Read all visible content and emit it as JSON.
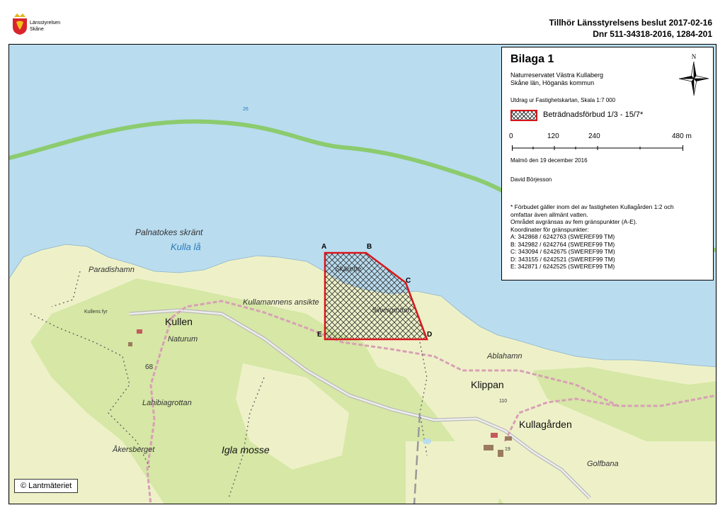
{
  "header": {
    "org_line1": "Länsstyrelsen",
    "org_line2": "Skåne",
    "decision": "Tillhör Länsstyrelsens beslut 2017-02-16",
    "dnr": "Dnr 511-34318-2016, 1284-201"
  },
  "legend": {
    "title": "Bilaga 1",
    "reserve": "Naturreservatet Västra Kullaberg",
    "county": "Skåne län, Höganäs kommun",
    "extract": "Utdrag ur Fastighetskartan, Skala 1:7 000",
    "swatch_label": "Beträdnadsförbud 1/3 - 15/7*",
    "scale": [
      "0",
      "120",
      "240",
      "480 m"
    ],
    "date": "Malmö den 19 december 2016",
    "author": "David Börjesson",
    "note": [
      "* Förbudet gäller inom del av fastigheten Kullagården 1:2 och",
      "omfattar även allmänt vatten.",
      "Området avgränsas av fem gränspunkter (A-E).",
      "Koordinater för gränspunkter:",
      "A: 342868 / 6242763 (SWEREF99 TM)",
      "B: 342982 / 6242764 (SWEREF99 TM)",
      "C: 343094 / 6242675 (SWEREF99 TM)",
      "D: 343155 / 6242521 (SWEREF99 TM)",
      "E: 342871 / 6242525 (SWEREF99 TM)"
    ],
    "north": "N"
  },
  "map": {
    "depth_label": "26",
    "labels": {
      "palnatokes": "Palnatokes skränt",
      "kulla_la": "Kulla lå",
      "paradishamn": "Paradishamn",
      "kullen": "Kullen",
      "naturum": "Naturum",
      "kullens_fyr": "Kullens fyr",
      "lahibiagrottan": "Lahibiagrottan",
      "akersberget": "Åkersberget",
      "igla_mosse": "Igla mosse",
      "kullamannens": "Kullamannens ansikte",
      "skarette": "Skärette",
      "silvergrottan": "Silvergrottan",
      "ablahamn": "Ablahamn",
      "klippan": "Klippan",
      "kullagarden": "Kullagården",
      "golfbana": "Golfbana",
      "h68": "68",
      "h110": "110",
      "h19": "19"
    },
    "points": [
      "A",
      "B",
      "C",
      "D",
      "E"
    ]
  },
  "copyright": "© Lantmäteriet",
  "colors": {
    "sea": "#b9dcef",
    "land": "#eef1c8",
    "forest": "#d6e7a6",
    "boundary": "#d7151b",
    "reserve_line": "#8ccb6e",
    "road": "#c7c7c7"
  }
}
